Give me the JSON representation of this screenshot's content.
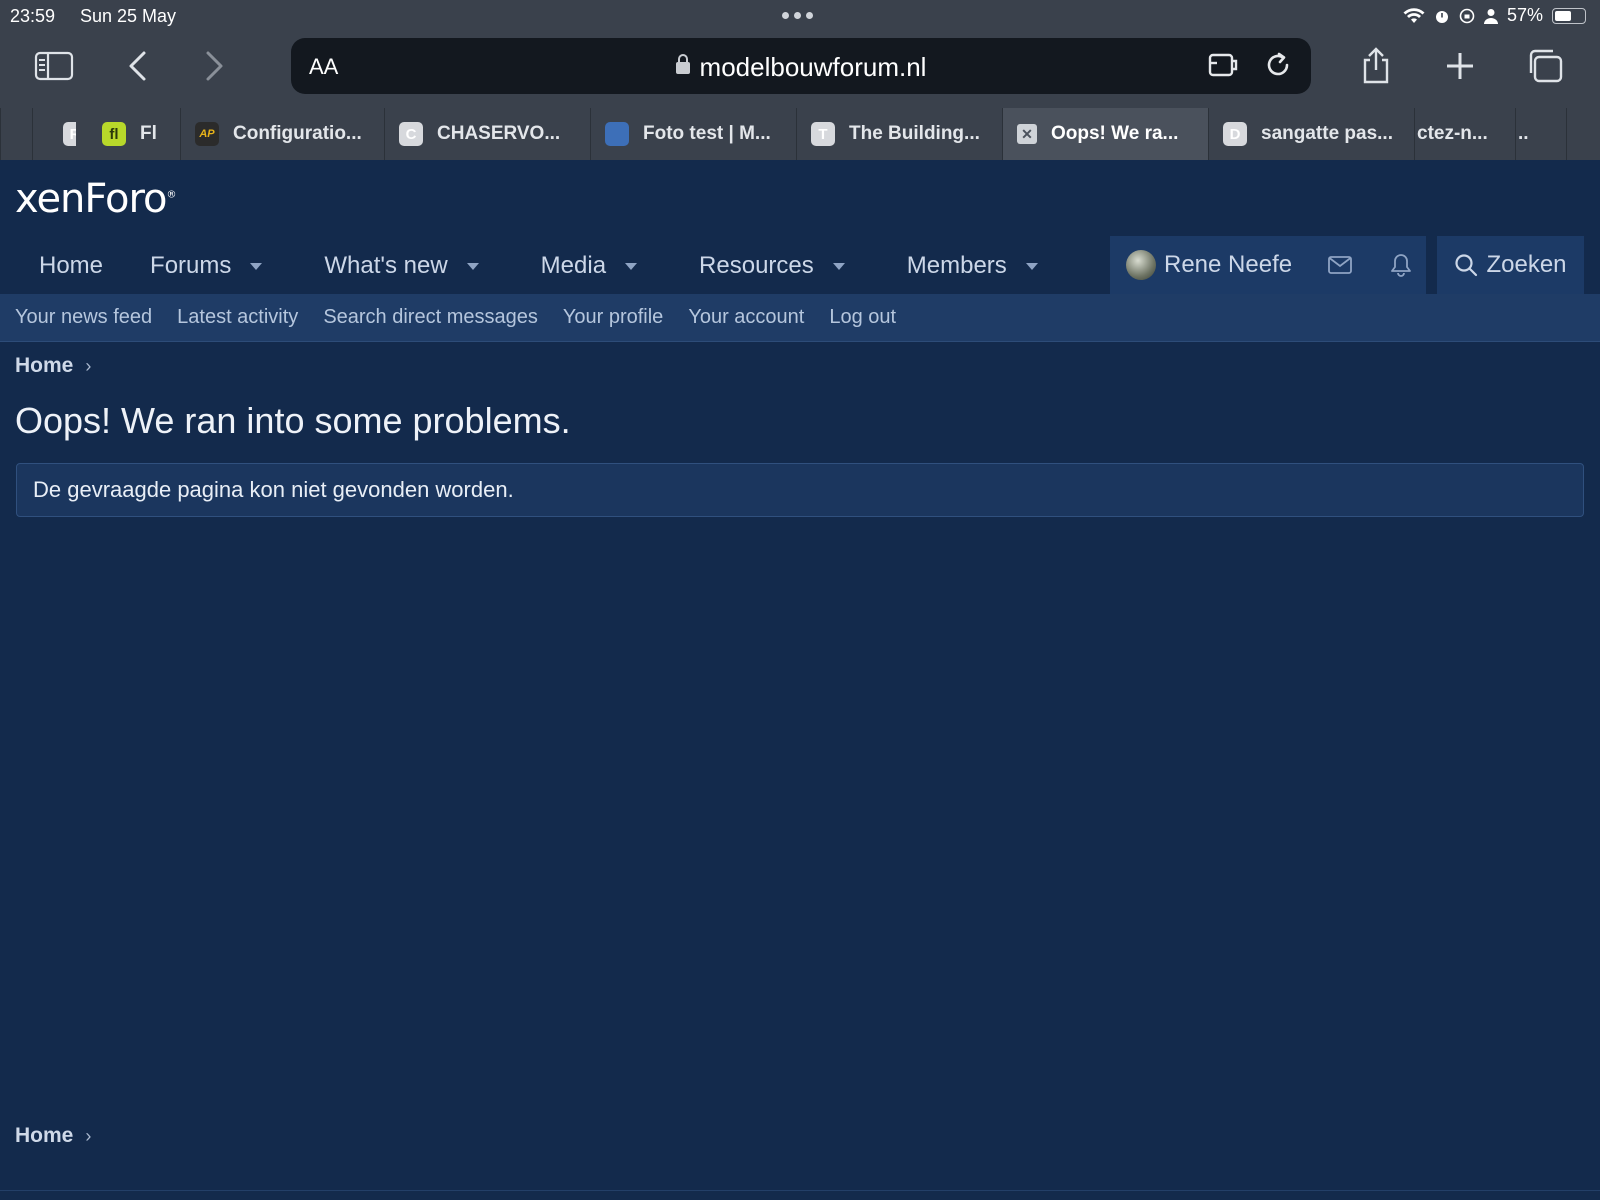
{
  "status_bar": {
    "time": "23:59",
    "date": "Sun 25 May",
    "battery": "57%",
    "battery_level": 0.57
  },
  "browser": {
    "aa_label": "AA",
    "url": "modelbouwforum.nl",
    "tabs": [
      {
        "favicon": "R",
        "label": "",
        "fav_color": "#d7d9dd"
      },
      {
        "favicon": "fl",
        "label": "Fl",
        "fav_color": "#b8d82a"
      },
      {
        "favicon": "AP",
        "label": "Configuratio...",
        "fav_color": "#2b2b2b"
      },
      {
        "favicon": "C",
        "label": "CHASERVO...",
        "fav_color": "#d7d9dd"
      },
      {
        "favicon": "globe",
        "label": "Foto test | M...",
        "fav_color": "#3d6fb8"
      },
      {
        "favicon": "T",
        "label": "The Building...",
        "fav_color": "#d7d9dd"
      },
      {
        "favicon": "✕",
        "label": "Oops! We ra...",
        "fav_color": "#cfd3d8"
      },
      {
        "favicon": "D",
        "label": "sangatte pas...",
        "fav_color": "#d7d9dd"
      },
      {
        "favicon": "",
        "label": "ctez-n...",
        "fav_color": ""
      },
      {
        "favicon": "",
        "label": "..",
        "fav_color": ""
      }
    ]
  },
  "site": {
    "logo": "xenForo",
    "nav": [
      "Home",
      "Forums",
      "What's new",
      "Media",
      "Resources",
      "Members"
    ],
    "user_name": "Rene Neefe",
    "search_label": "Zoeken",
    "subnav": [
      "Your news feed",
      "Latest activity",
      "Search direct messages",
      "Your profile",
      "Your account",
      "Log out"
    ],
    "breadcrumb_home": "Home",
    "page_title": "Oops! We ran into some problems.",
    "error_message": "De gevraagde pagina kon niet gevonden worden.",
    "footer_breadcrumb_home": "Home"
  }
}
